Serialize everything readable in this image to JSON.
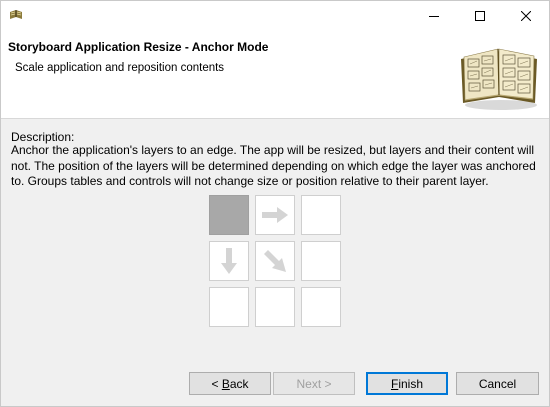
{
  "window": {
    "icon": "storyboard-app-icon"
  },
  "controls": {
    "minimize_icon": "minimize-icon",
    "maximize_icon": "maximize-icon",
    "close_icon": "close-icon"
  },
  "banner": {
    "title": "Storyboard Application Resize - Anchor Mode",
    "subtitle": "Scale application and reposition contents",
    "image": "open-storyboard-book-image"
  },
  "description": {
    "label": "Description:",
    "text": "Anchor the application's layers to an edge.  The app will be resized, but layers and their content will not.  The position of the layers will be determined depending on which edge the layer was anchored to.  Groups tables and controls will not change size or position relative to their parent layer."
  },
  "anchor_grid": {
    "selected_cell": "top-left",
    "cells": [
      {
        "id": "top-left",
        "icon": "none",
        "selected": true
      },
      {
        "id": "top-center",
        "icon": "arrow-right-icon",
        "selected": false
      },
      {
        "id": "top-right",
        "icon": "none",
        "selected": false
      },
      {
        "id": "middle-left",
        "icon": "arrow-down-icon",
        "selected": false
      },
      {
        "id": "center",
        "icon": "arrow-down-right-icon",
        "selected": false
      },
      {
        "id": "middle-right",
        "icon": "none",
        "selected": false
      },
      {
        "id": "bottom-left",
        "icon": "none",
        "selected": false
      },
      {
        "id": "bottom-center",
        "icon": "none",
        "selected": false
      },
      {
        "id": "bottom-right",
        "icon": "none",
        "selected": false
      }
    ],
    "arrow_color": "#d4d4d4",
    "selected_color": "#a8a8a8"
  },
  "buttons": {
    "back_prefix": "< ",
    "back_mnemonic": "B",
    "back_rest": "ack",
    "next_label": "Next >",
    "finish_mnemonic": "F",
    "finish_rest": "inish",
    "cancel_label": "Cancel"
  }
}
